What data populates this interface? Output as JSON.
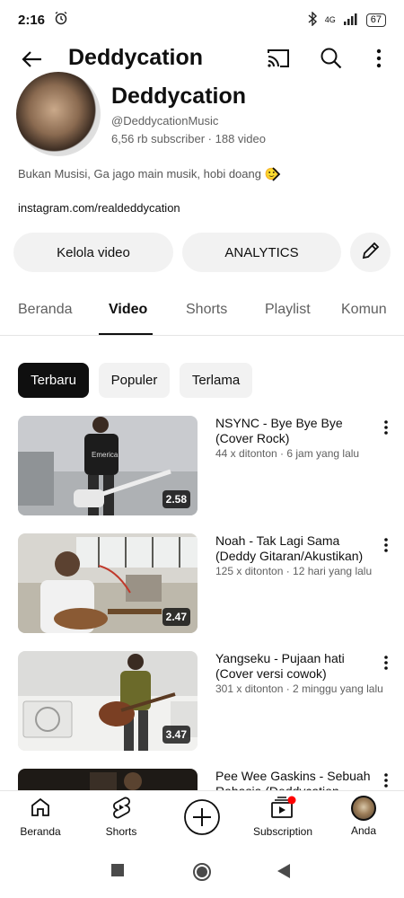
{
  "status": {
    "time": "2:16",
    "network": "4G",
    "battery": "67"
  },
  "header": {
    "title": "Deddycation"
  },
  "channel": {
    "name": "Deddycation",
    "handle": "@DeddycationMusic",
    "stats": "6,56 rb subscriber · 188 video",
    "bio": "Bukan Musisi, Ga jago main musik, hobi doang 🙂",
    "link": "instagram.com/realdeddycation"
  },
  "actions": {
    "manage_label": "Kelola video",
    "analytics_label": "ANALYTICS"
  },
  "tabs": [
    {
      "label": "Beranda"
    },
    {
      "label": "Video"
    },
    {
      "label": "Shorts"
    },
    {
      "label": "Playlist"
    },
    {
      "label": "Komun"
    }
  ],
  "chips": [
    {
      "label": "Terbaru"
    },
    {
      "label": "Populer"
    },
    {
      "label": "Terlama"
    }
  ],
  "videos": [
    {
      "title": "NSYNC - Bye Bye Bye (Cover Rock)",
      "meta": "44 x ditonton · 6 jam yang lalu",
      "duration": "2.58"
    },
    {
      "title": "Noah - Tak Lagi Sama (Deddy Gitaran/Akustikan)",
      "meta": "125 x ditonton · 12 hari yang lalu",
      "duration": "2.47"
    },
    {
      "title": "Yangseku - Pujaan hati (Cover versi cowok)",
      "meta": "301 x ditonton · 2 minggu yang lalu",
      "duration": "3.47"
    },
    {
      "title": "Pee Wee Gaskins - Sebuah Rahasia (Deddycation",
      "meta": "",
      "duration": ""
    }
  ],
  "thumb_text": "Emerica",
  "bottom_nav": {
    "home": "Beranda",
    "shorts": "Shorts",
    "subs": "Subscription",
    "you": "Anda"
  },
  "colors": {
    "accent": "#ff0000",
    "text": "#0f0f0f",
    "muted": "#606060",
    "chip_bg": "#f2f2f2"
  }
}
